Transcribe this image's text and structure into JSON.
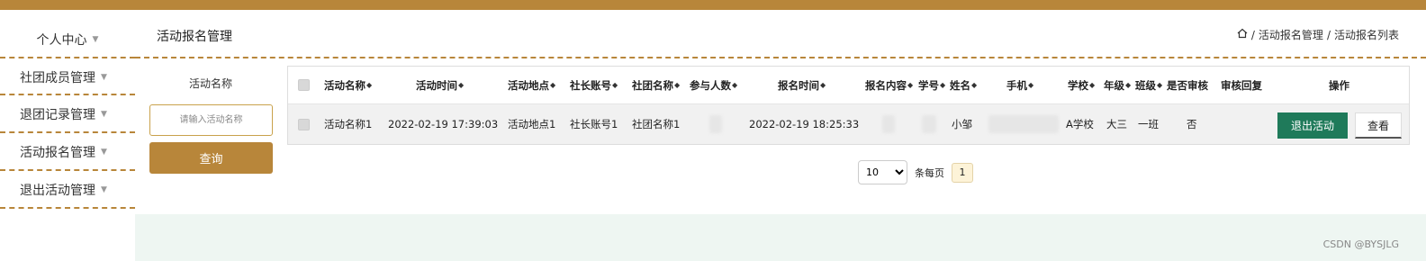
{
  "sidebar": {
    "items": [
      {
        "label": "个人中心"
      },
      {
        "label": "社团成员管理"
      },
      {
        "label": "退团记录管理"
      },
      {
        "label": "活动报名管理"
      },
      {
        "label": "退出活动管理"
      }
    ]
  },
  "header": {
    "title": "活动报名管理",
    "breadcrumb": [
      "活动报名管理",
      "活动报名列表"
    ],
    "breadcrumb_sep": "/"
  },
  "search": {
    "label": "活动名称",
    "placeholder": "请输入活动名称",
    "button": "查询"
  },
  "table": {
    "columns": [
      "活动名称",
      "活动时间",
      "活动地点",
      "社长账号",
      "社团名称",
      "参与人数",
      "报名时间",
      "报名内容",
      "学号",
      "姓名",
      "手机",
      "学校",
      "年级",
      "班级",
      "是否审核",
      "审核回复",
      "操作"
    ],
    "rows": [
      {
        "活动名称": "活动名称1",
        "活动时间": "2022-02-19 17:39:03",
        "活动地点": "活动地点1",
        "社长账号": "社长账号1",
        "社团名称": "社团名称1",
        "报名时间": "2022-02-19 18:25:33",
        "姓名": "小邹",
        "学校": "A学校",
        "年级": "大三",
        "班级": "一班",
        "是否审核": "否",
        "actions": {
          "exit": "退出活动",
          "view": "查看"
        }
      }
    ]
  },
  "pagination": {
    "page_size": "10",
    "per_page_label": "条每页",
    "current_page": "1"
  },
  "watermark": "CSDN @BYSJLG",
  "colors": {
    "accent": "#b8863a",
    "exit_button": "#1f7a5a"
  }
}
